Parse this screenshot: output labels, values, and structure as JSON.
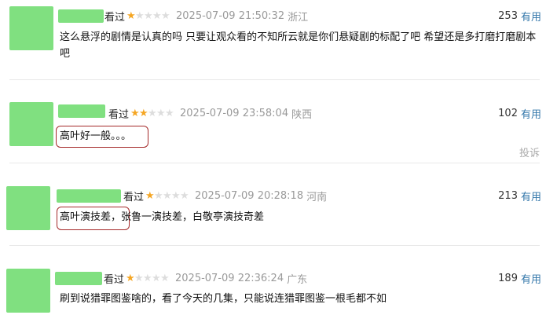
{
  "comments": [
    {
      "status": "看过",
      "rating": 1,
      "time": "2025-07-09 21:50:32",
      "location": "浙江",
      "votes": "253",
      "useful_label": "有用",
      "text": "这么悬浮的剧情是认真的吗 只要让观众看的不知所云就是你们悬疑剧的标配了吧 希望还是多打磨打磨剧本吧"
    },
    {
      "status": "看过",
      "rating": 2,
      "time": "2025-07-09 23:58:04",
      "location": "陕西",
      "votes": "102",
      "useful_label": "有用",
      "text": "高叶好一般。。。",
      "report_label": "投诉"
    },
    {
      "status": "看过",
      "rating": 1,
      "time": "2025-07-09 20:28:18",
      "location": "河南",
      "votes": "213",
      "useful_label": "有用",
      "text": "高叶演技差，张鲁一演技差，白敬亭演技奇差"
    },
    {
      "status": "看过",
      "rating": 1,
      "time": "2025-07-09 22:36:24",
      "location": "广东",
      "votes": "189",
      "useful_label": "有用",
      "text": "刷到说猎罪图鉴啥的，看了今天的几集，只能说连猎罪图鉴一根毛都不如"
    }
  ],
  "colors": {
    "avatar_placeholder": "#80e080",
    "star_on": "#f5a623",
    "star_off": "#dddddd",
    "useful_link": "#3377aa",
    "highlight_box": "#a52a2a"
  }
}
